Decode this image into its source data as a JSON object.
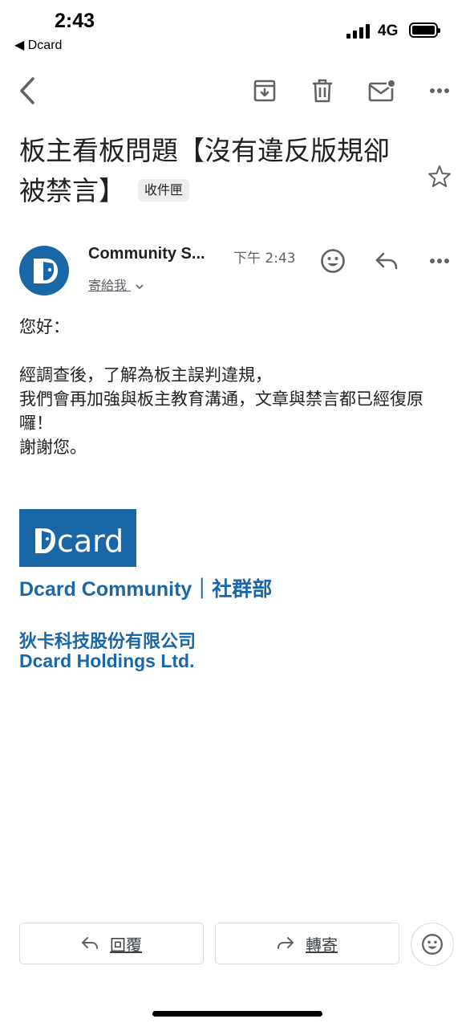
{
  "status_bar": {
    "time": "2:43",
    "back_app": "◀ Dcard",
    "network": "4G"
  },
  "toolbar": {
    "icons": [
      "back-icon",
      "archive-icon",
      "trash-icon",
      "mark-unread-icon",
      "more-icon"
    ]
  },
  "email": {
    "subject": "板主看板問題【沒有違反版規卻被禁言】",
    "folder_label": "收件匣",
    "sender": "Community S...",
    "time": "下午 2:43",
    "to_me": "寄給我",
    "body": [
      "您好：",
      "",
      "經調查後，了解為板主誤判違規，",
      "我們會再加強與板主教育溝通，文章與禁言都已經復原囉！",
      "謝謝您。"
    ]
  },
  "signature": {
    "logo_text": "card",
    "line1": "Dcard Community｜社群部",
    "line2": "狄卡科技股份有限公司",
    "line3": "Dcard Holdings Ltd."
  },
  "actions": {
    "reply_label": "回覆",
    "forward_label": "轉寄"
  },
  "colors": {
    "brand": "#1967a7",
    "icon": "#5f6368"
  }
}
